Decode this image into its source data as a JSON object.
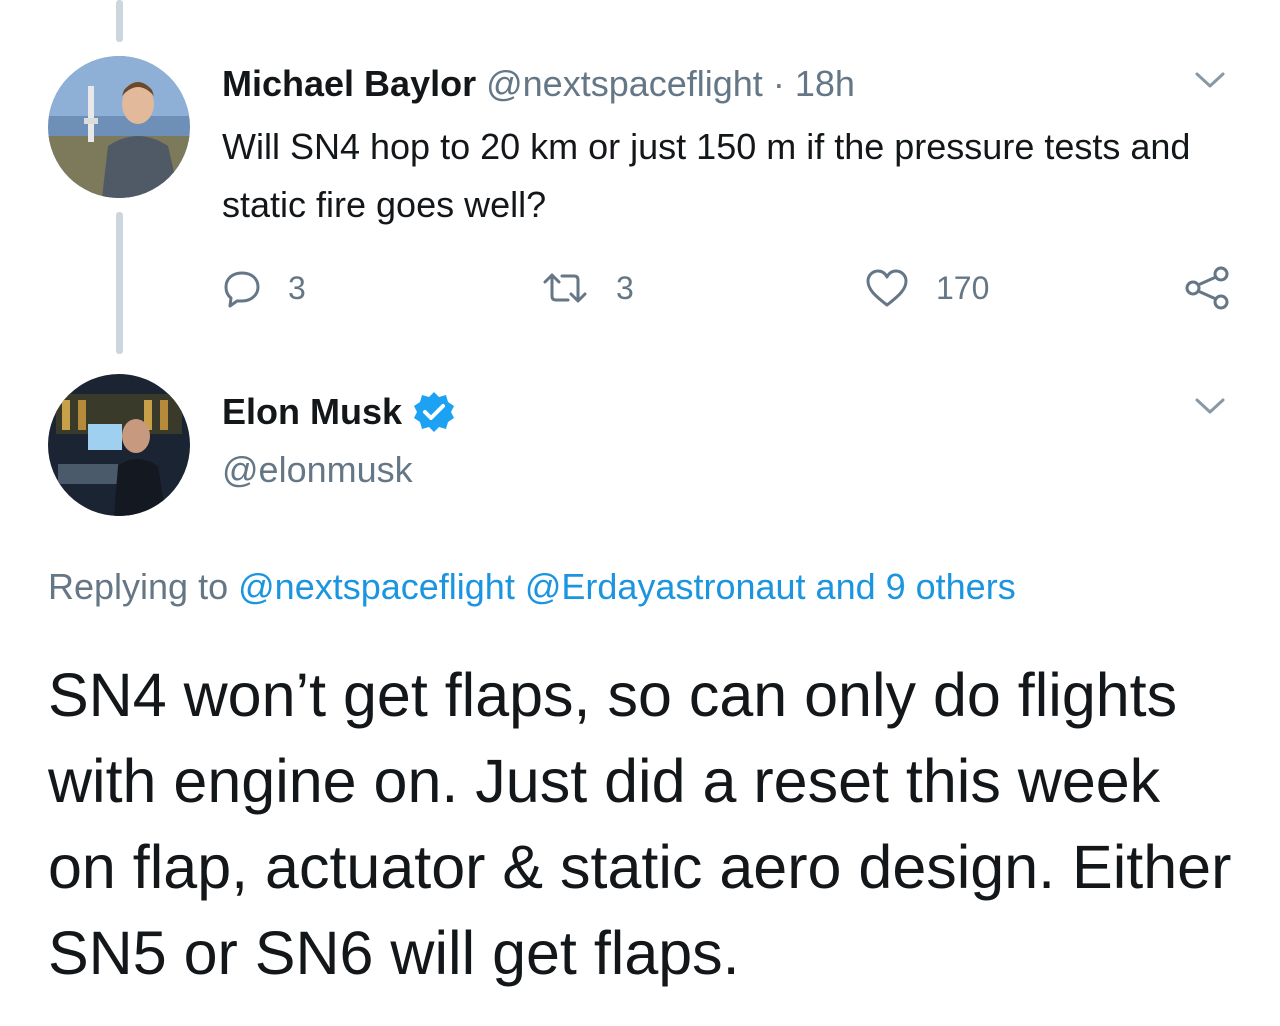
{
  "parent_tweet": {
    "author_name": "Michael Baylor",
    "handle": "@nextspaceflight",
    "separator": "·",
    "time": "18h",
    "text": "Will SN4 hop to 20 km or just 150 m if the pressure tests and static fire goes well?",
    "avatar_icon": "avatar-photo",
    "menu_icon": "chevron-down-icon",
    "actions": {
      "replies": "3",
      "retweets": "3",
      "likes": "170"
    }
  },
  "reply_tweet": {
    "author_name": "Elon Musk",
    "verified_icon": "verified-badge-icon",
    "handle": "@elonmusk",
    "avatar_icon": "avatar-photo",
    "menu_icon": "chevron-down-icon",
    "replying_prefix": "Replying to",
    "replying_mention_1": "@nextspaceflight",
    "replying_mention_2": "@Erdayastronaut",
    "replying_others": "and 9 others",
    "text": "SN4 won’t get flaps, so can only do flights with engine on. Just did a reset this week on flap, actuator & static aero design. Either SN5 or SN6 will get flaps."
  },
  "colors": {
    "text_primary": "#14171a",
    "text_secondary": "#657786",
    "link": "#1b95e0",
    "verified": "#1da1f2",
    "thread_line": "#ccd6dd"
  }
}
